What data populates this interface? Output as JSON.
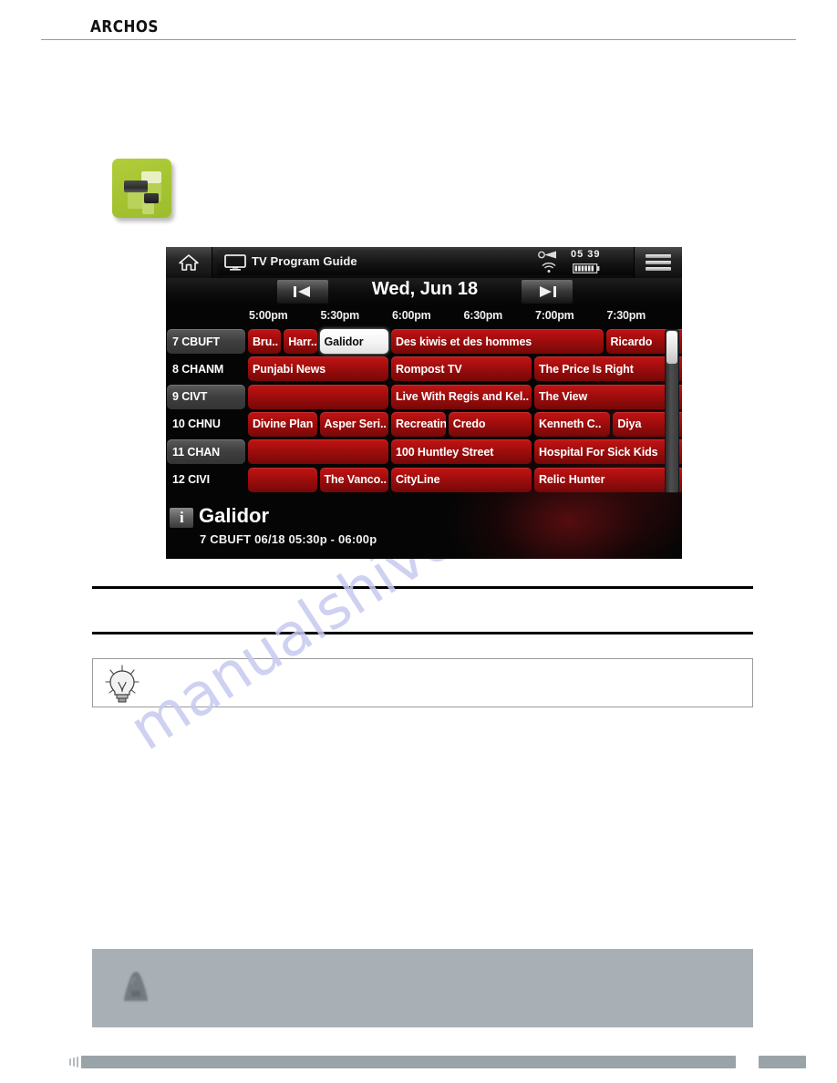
{
  "page": {
    "brand": "ARCHOS",
    "watermark": "manualshive.com"
  },
  "app_icon": {
    "name": "tv-program-guide-app-icon"
  },
  "device": {
    "topbar": {
      "home_icon": "home-icon",
      "tv_icon": "tv-screen-icon",
      "title": "TV Program Guide",
      "status": {
        "clock": "05 39",
        "hdd_icon": "hdd-activity-icon",
        "wifi_icon": "wifi-icon",
        "battery_icon": "battery-icon"
      },
      "menu_icon": "menu-icon"
    },
    "datebar": {
      "prev_label": "prev-day-icon",
      "date": "Wed, Jun 18",
      "next_label": "next-day-icon"
    },
    "times": [
      "5:00pm",
      "5:30pm",
      "6:00pm",
      "6:30pm",
      "7:00pm",
      "7:30pm"
    ],
    "channels": [
      {
        "label": "7 CBUFT",
        "highlighted": true
      },
      {
        "label": "8 CHANM",
        "highlighted": false
      },
      {
        "label": "9 CIVT",
        "highlighted": true
      },
      {
        "label": "10 CHNU",
        "highlighted": false
      },
      {
        "label": "11 CHAN",
        "highlighted": true
      },
      {
        "label": "12 CIVI",
        "highlighted": false
      }
    ],
    "programs": [
      [
        {
          "title": "Bru..",
          "start": 0,
          "span": 0.5,
          "selected": false
        },
        {
          "title": "Harr..",
          "start": 0.5,
          "span": 0.5,
          "selected": false
        },
        {
          "title": "Galidor",
          "start": 1.0,
          "span": 1.0,
          "selected": true
        },
        {
          "title": "Des kiwis et des hommes",
          "start": 2.0,
          "span": 3.0,
          "selected": false
        },
        {
          "title": "Ricardo",
          "start": 5.0,
          "span": 1.2,
          "selected": false
        }
      ],
      [
        {
          "title": "Punjabi News",
          "start": 0,
          "span": 2.0,
          "selected": false
        },
        {
          "title": "Rompost TV",
          "start": 2.0,
          "span": 2.0,
          "selected": false
        },
        {
          "title": "The Price Is Right",
          "start": 4.0,
          "span": 2.2,
          "selected": false
        }
      ],
      [
        {
          "title": "",
          "start": 0,
          "span": 2.0,
          "selected": false
        },
        {
          "title": "Live With Regis and Kel..",
          "start": 2.0,
          "span": 2.0,
          "selected": false
        },
        {
          "title": "The View",
          "start": 4.0,
          "span": 2.2,
          "selected": false
        }
      ],
      [
        {
          "title": "Divine Plan",
          "start": 0,
          "span": 1.0,
          "selected": false
        },
        {
          "title": "Asper Seri..",
          "start": 1.0,
          "span": 1.0,
          "selected": false
        },
        {
          "title": "Recreating..",
          "start": 2.0,
          "span": 0.8,
          "selected": false
        },
        {
          "title": "Credo",
          "start": 2.8,
          "span": 1.2,
          "selected": false
        },
        {
          "title": "Kenneth C..",
          "start": 4.0,
          "span": 1.1,
          "selected": false
        },
        {
          "title": "Diya",
          "start": 5.1,
          "span": 1.1,
          "selected": false
        }
      ],
      [
        {
          "title": "",
          "start": 0,
          "span": 2.0,
          "selected": false
        },
        {
          "title": "100 Huntley Street",
          "start": 2.0,
          "span": 2.0,
          "selected": false
        },
        {
          "title": "Hospital For Sick Kids",
          "start": 4.0,
          "span": 2.2,
          "selected": false
        }
      ],
      [
        {
          "title": "",
          "start": 0,
          "span": 1.0,
          "selected": false
        },
        {
          "title": "The Vanco..",
          "start": 1.0,
          "span": 1.0,
          "selected": false
        },
        {
          "title": "CityLine",
          "start": 2.0,
          "span": 2.0,
          "selected": false
        },
        {
          "title": "Relic Hunter",
          "start": 4.0,
          "span": 2.2,
          "selected": false
        }
      ]
    ],
    "info": {
      "icon": "info-icon",
      "title": "Galidor",
      "subtitle": "7 CBUFT   06/18 05:30p - 06:00p"
    }
  },
  "tipbox": {
    "icon": "lightbulb-tip-icon",
    "text": ""
  },
  "notebox": {
    "icon": "warning-triangle-icon",
    "text": ""
  },
  "colors": {
    "program_red": "#a00d0d",
    "selected_white": "#ffffff",
    "app_icon_green": "#a7c532",
    "note_grey": "#a8b0b5",
    "footer_grey": "#9aa3a8"
  }
}
